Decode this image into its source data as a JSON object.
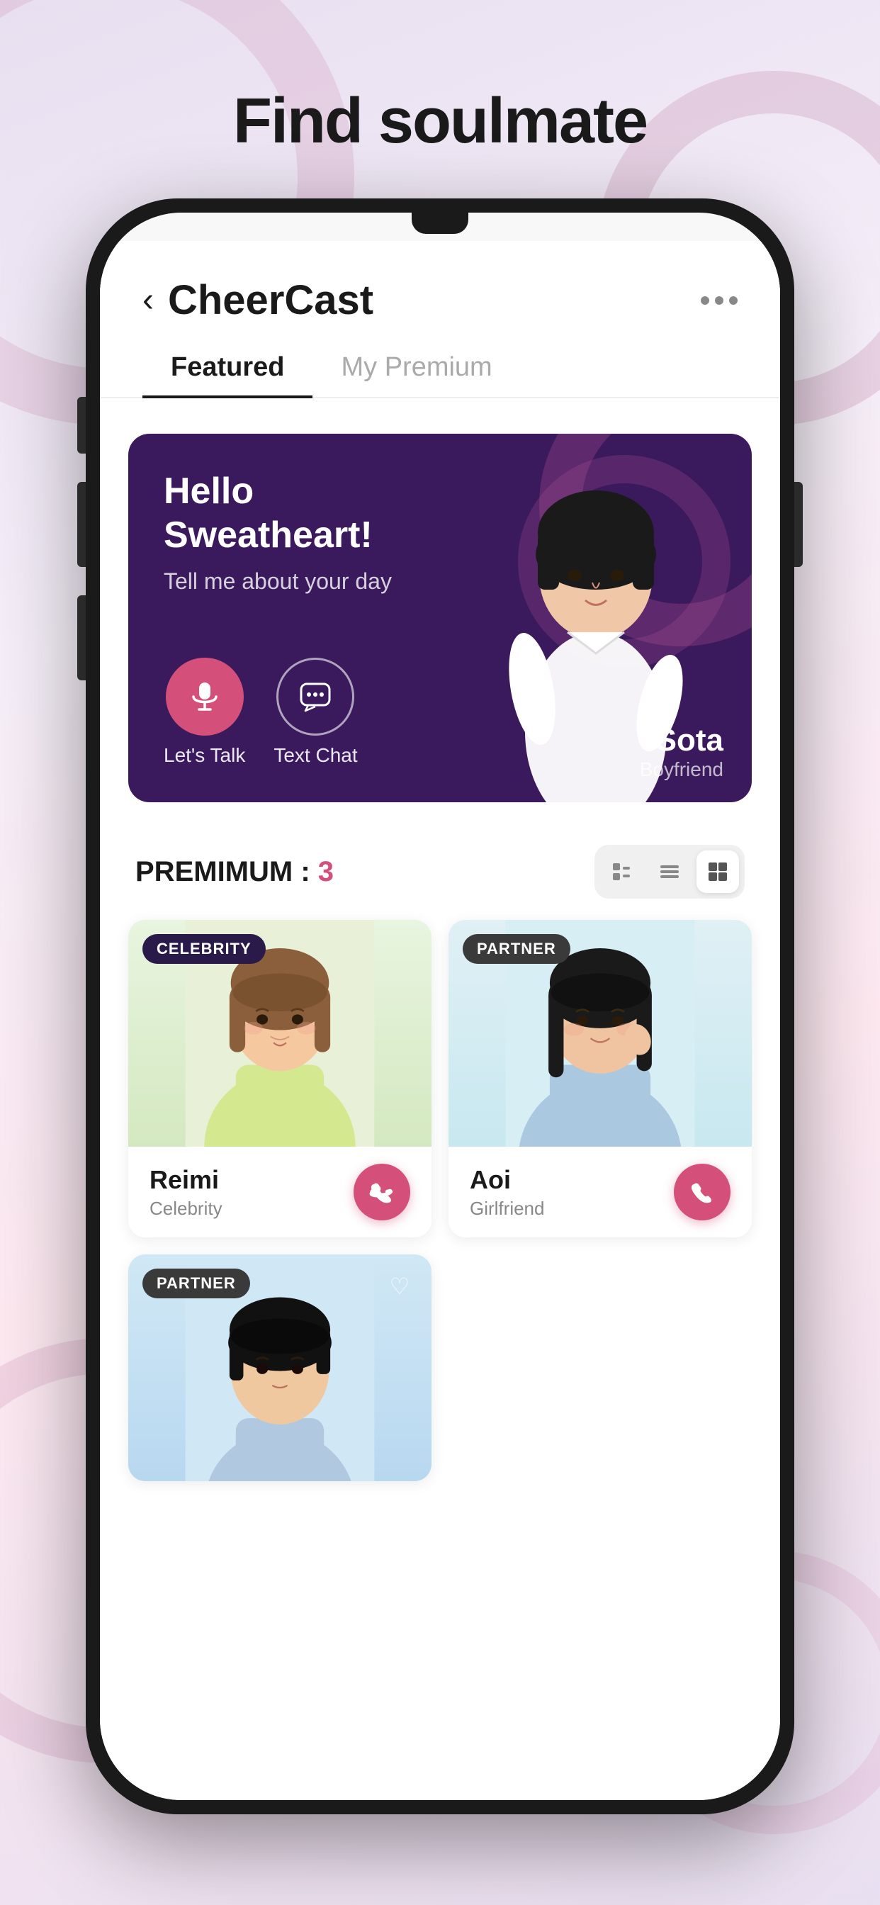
{
  "page": {
    "title": "Find soulmate",
    "background": {
      "color1": "#e8dff0",
      "color2": "#f5eef8",
      "color3": "#fde8f0"
    }
  },
  "header": {
    "app_name": "CheerCast",
    "back_label": "‹",
    "more_icon": "dots"
  },
  "tabs": [
    {
      "label": "Featured",
      "active": true
    },
    {
      "label": "My Premium",
      "active": false
    }
  ],
  "hero": {
    "greeting": "Hello\nSweatheart!",
    "subtitle": "Tell me about your day",
    "actions": [
      {
        "label": "Let's Talk",
        "type": "filled"
      },
      {
        "label": "Text Chat",
        "type": "outline"
      }
    ],
    "character": {
      "name": "Sota",
      "role": "Boyfriend"
    }
  },
  "premium": {
    "label": "PREMIMUM :",
    "count": "3",
    "view_modes": [
      "card",
      "list",
      "grid"
    ]
  },
  "cards": [
    {
      "name": "Reimi",
      "role": "Celebrity",
      "badge": "CELEBRITY",
      "badge_type": "celebrity",
      "bg_color": "#e8f0d8"
    },
    {
      "name": "Aoi",
      "role": "Girlfriend",
      "badge": "PARTNER",
      "badge_type": "partner",
      "bg_color": "#d8eef5"
    },
    {
      "name": "",
      "role": "",
      "badge": "PARTNER",
      "badge_type": "partner",
      "bg_color": "#d0e8f5",
      "partial": true
    }
  ]
}
